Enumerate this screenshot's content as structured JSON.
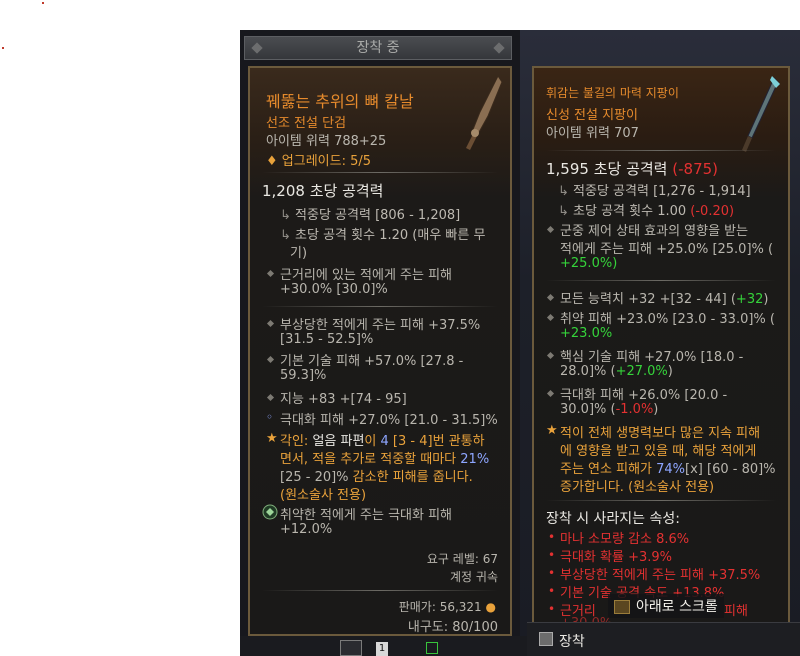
{
  "header": {
    "label": "장착 중"
  },
  "left": {
    "name": "꿰뚫는 추위의 뼈 칼날",
    "type": "선조 전설 단검",
    "item_power": "아이템 위력 788+25",
    "upgrade": "업그레이드: 5/5",
    "dps": "1,208 초당 공격력",
    "dmg_per_hit": "적중당 공격력 [806 - 1,208]",
    "attacks_per_sec_1": "초당 공격 횟수 1.20 (매우 빠른 무",
    "attacks_per_sec_2": "기)",
    "implicit_1": "근거리에 있는 적에게 주는 피해",
    "implicit_2": "+30.0% [30.0]%",
    "affixes": [
      {
        "l1": "부상당한 적에게 주는 피해 +37.5%",
        "l2": "[31.5 - 52.5]%"
      },
      {
        "l1": "기본 기술 피해 +57.0% [27.8 -",
        "l2": "59.3]%"
      },
      {
        "l1": "지능 +83 +[74 - 95]",
        "l2": ""
      },
      {
        "l1": "극대화 피해 +27.0% [21.0 - 31.5]%",
        "l2": ""
      }
    ],
    "aspect": {
      "l1a": "각인: ",
      "l1b": "얼음 파편",
      "l1c": "이 ",
      "l1d": "4",
      "l1e": " [3 - 4]번 관통하",
      "l2a": "면서, 적을 추가로 적중할 때마다 ",
      "l2b": "21%",
      "l3a": "[25 - 20]%",
      "l3b": " 감소한 피해를 줍니다.",
      "l4": "(원소술사 전용)"
    },
    "socket_1": "취약한 적에게 주는 극대화 피해",
    "socket_2": "+12.0%",
    "req_level": "요구 레벨: 67",
    "bound": "계정 귀속",
    "sell": "판매가: 56,321",
    "durability": "내구도: 80/100"
  },
  "right": {
    "name": "휘감는 불길의 마력 지팡이",
    "type": "신성 전설 지팡이",
    "item_power": "아이템 위력 707",
    "dps": "1,595 초당 공격력",
    "dps_diff": "(-875)",
    "dmg_per_hit": "적중당 공격력 [1,276 - 1,914]",
    "aps": "초당 공격 횟수 1.00",
    "aps_diff": "(-0.20)",
    "implicit_1": "군중 제어 상태 효과의 영향을 받는",
    "implicit_2": "적에게 주는 피해 +25.0% [25.0]% (",
    "implicit_3": "+25.0%)",
    "affixes": [
      {
        "l1a": "모든 능력치 +32 +[32 - 44] (",
        "l1b": "+32",
        "l1c": ")",
        "l2a": "",
        "l2b": ""
      },
      {
        "l1a": "취약 피해 +23.0% [23.0 - 33.0]% (",
        "l1b": "",
        "l1c": "",
        "l2a": "",
        "l2b": "+23.0%"
      },
      {
        "l1a": "핵심 기술 피해 +27.0% [18.0 -",
        "l1b": "",
        "l1c": "",
        "l2a": "28.0]% (",
        "l2b": "+27.0%"
      },
      {
        "l1a": "극대화 피해 +26.0% [20.0 -",
        "l1b": "",
        "l1c": "",
        "l2a": "30.0]% (",
        "l2b": "-1.0%"
      }
    ],
    "aspect": {
      "l1": "적이 전체 생명력보다 많은 지속 피해",
      "l2": "에 영향을 받고 있을 때, 해당 적에게",
      "l3a": "주는 연소 피해가 ",
      "l3b": "74%",
      "l3c": "[x] [60 - 80]%",
      "l4": "증가합니다. (원소술사 전용)"
    },
    "lost_header": "장착 시 사라지는 속성:",
    "lost": [
      "마나 소모량 감소 8.6%",
      "극대화 확률 +3.9%",
      "부상당한 적에게 주는 피해 +37.5%",
      "기본 기술 공격 속도 +13.8%",
      "근거리"
    ],
    "lost_tail": "피해",
    "lost_partial": "+30.0%"
  },
  "scroll_hint": "아래로 스크롤",
  "bottom": {
    "equip": "장착",
    "badge": "1"
  },
  "colors": {
    "legendary": "#e58a2c",
    "positive": "#35d33a",
    "negative": "#e33131"
  }
}
